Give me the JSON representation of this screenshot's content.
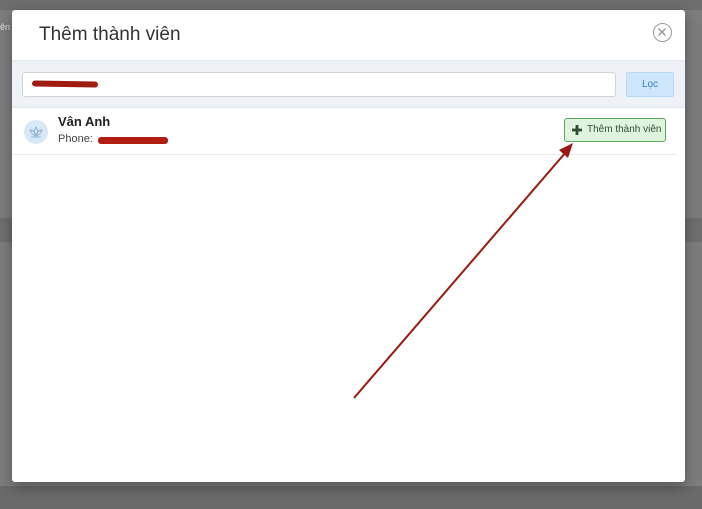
{
  "background": {
    "left_fragment": "ên"
  },
  "modal": {
    "title": "Thêm thành viên"
  },
  "search": {
    "value": "",
    "filter_label": "Lọc"
  },
  "members": [
    {
      "name": "Vân Anh",
      "phone_label": "Phone:",
      "add_button_label": "Thêm thành viên"
    }
  ],
  "colors": {
    "add_button_bg": "#dff3df",
    "add_button_border": "#5aa85a",
    "filter_button_bg": "#cde6fb",
    "annotation_arrow": "#9b1a10"
  }
}
